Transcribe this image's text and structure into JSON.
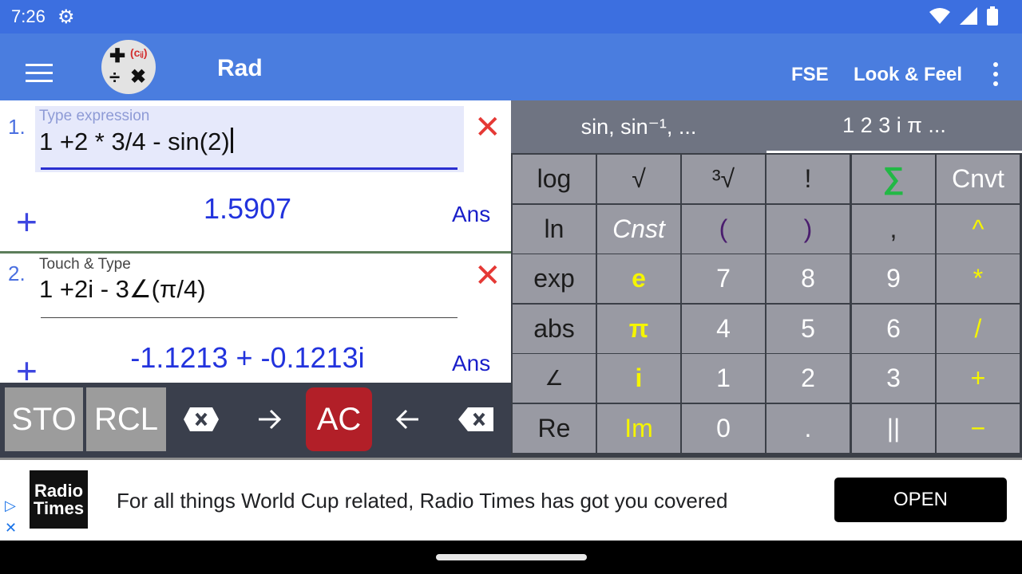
{
  "status_bar": {
    "time": "7:26",
    "settings_icon": "gear-icon",
    "icons": [
      "wifi-icon",
      "signal-icon",
      "battery-icon"
    ]
  },
  "app_bar": {
    "mode": "Rad",
    "actions": [
      "FSE",
      "Look & Feel"
    ]
  },
  "entries": [
    {
      "index": "1.",
      "hint": "Type expression",
      "expression": "1 +2 * 3/4 - sin(2)",
      "result": "1.5907",
      "ans_label": "Ans",
      "add_symbol": "+",
      "delete_symbol": "✕"
    },
    {
      "index": "2.",
      "hint": "Touch & Type",
      "expression": "1 +2i - 3∠(π/4)",
      "result": "-1.1213 + -0.1213i",
      "ans_label": "Ans",
      "add_symbol": "+",
      "delete_symbol": "✕"
    }
  ],
  "toolbar": {
    "sto": "STO",
    "rcl": "RCL",
    "clear_icon": "clear-field-icon",
    "forward_icon": "arrow-right-icon",
    "ac": "AC",
    "back_icon": "arrow-left-icon",
    "backspace_icon": "backspace-icon"
  },
  "keypad_tabs": [
    "sin, sin⁻¹, ...",
    "1 2 3 i π ..."
  ],
  "keys": [
    [
      "log",
      "√",
      "³√",
      "!",
      "∑",
      "Cnvt"
    ],
    [
      "ln",
      "Cnst",
      "(",
      ")",
      ",",
      "^"
    ],
    [
      "exp",
      "e",
      "7",
      "8",
      "9",
      "*"
    ],
    [
      "abs",
      "π",
      "4",
      "5",
      "6",
      "/"
    ],
    [
      "∠",
      "i",
      "1",
      "2",
      "3",
      "+"
    ],
    [
      "Re",
      "Im",
      "0",
      ".",
      "||",
      "−"
    ]
  ],
  "colors": {
    "app_bar": "#4a7ddf",
    "status_bar": "#3c6fe0",
    "key_bg": "#999aa3",
    "yellow_key_text": "#f5f500",
    "sum_key_text": "#22b845",
    "ac_button": "#b21f28",
    "result_text": "#2233dd"
  },
  "ad": {
    "brand": [
      "Radio",
      "Times"
    ],
    "text": "For all things World Cup related, Radio Times has got you covered",
    "button": "OPEN"
  }
}
